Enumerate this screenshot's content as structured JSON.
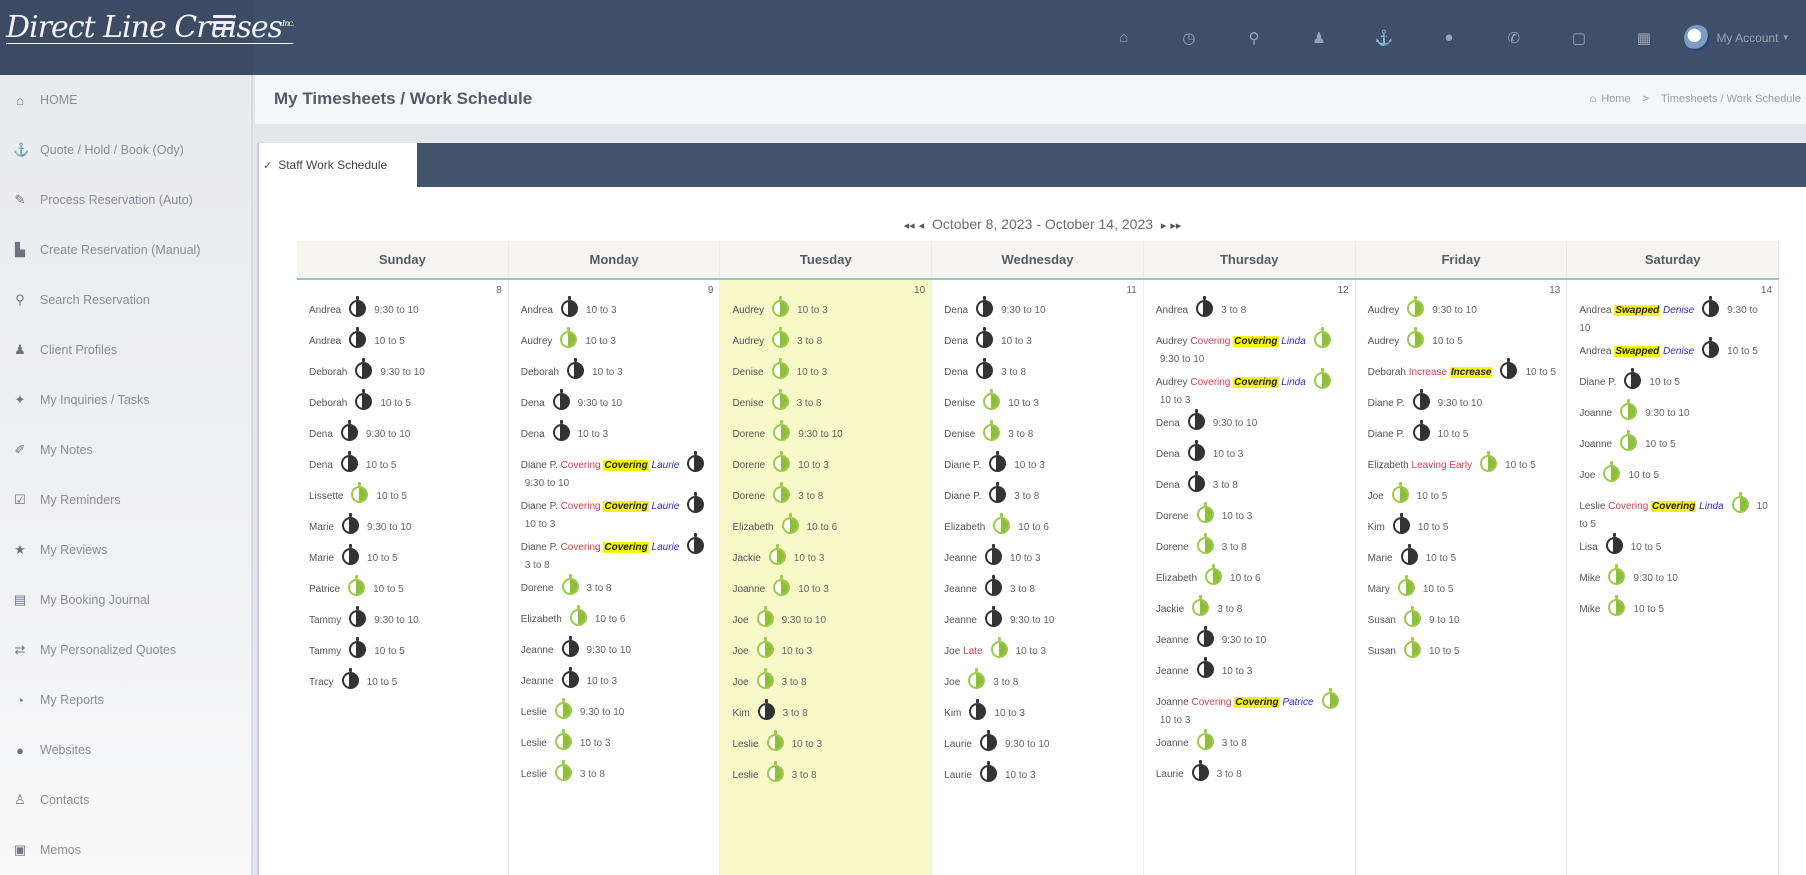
{
  "app": {
    "logo_text": "Direct Line Cruises",
    "logo_tm": "Inc."
  },
  "topnav": {
    "icons": [
      "home-icon",
      "clock-icon",
      "search-icon",
      "person-icon",
      "anchor-icon",
      "globe-icon",
      "phone-icon",
      "square-icon",
      "calendar-icon"
    ],
    "account_label": "My Account"
  },
  "sidebar": {
    "items": [
      {
        "icon": "home-icon",
        "glyph": "⌂",
        "label": "HOME"
      },
      {
        "icon": "anchor-icon",
        "glyph": "⚓",
        "label": "Quote / Hold / Book (Ody)"
      },
      {
        "icon": "pencil-icon",
        "glyph": "✎",
        "label": "Process Reservation (Auto)"
      },
      {
        "icon": "file-icon",
        "glyph": "▙",
        "label": "Create Reservation (Manual)"
      },
      {
        "icon": "search-icon",
        "glyph": "⚲",
        "label": "Search Reservation"
      },
      {
        "icon": "person-icon",
        "glyph": "♟",
        "label": "Client Profiles"
      },
      {
        "icon": "ticket-icon",
        "glyph": "✦",
        "label": "My Inquiries / Tasks"
      },
      {
        "icon": "paperclip-icon",
        "glyph": "✐",
        "label": "My Notes"
      },
      {
        "icon": "checkbox-icon",
        "glyph": "☑",
        "label": "My Reminders"
      },
      {
        "icon": "star-icon",
        "glyph": "★",
        "label": "My Reviews"
      },
      {
        "icon": "book-icon",
        "glyph": "▤",
        "label": "My Booking Journal"
      },
      {
        "icon": "exchange-icon",
        "glyph": "⇄",
        "label": "My Personalized Quotes"
      },
      {
        "icon": "dashboard-icon",
        "glyph": "◔",
        "label": "My Reports"
      },
      {
        "icon": "globe-icon",
        "glyph": "●",
        "label": "Websites"
      },
      {
        "icon": "user-icon",
        "glyph": "♙",
        "label": "Contacts"
      },
      {
        "icon": "memo-icon",
        "glyph": "▣",
        "label": "Memos"
      }
    ]
  },
  "header": {
    "title": "My Timesheets / Work Schedule",
    "breadcrumb": {
      "home": "Home",
      "separator": ">",
      "current": "Timesheets / Work Schedule"
    }
  },
  "tabs": [
    {
      "label": "Staff Work Schedule",
      "active": true
    }
  ],
  "week": {
    "range": "October 8, 2023 - October 14, 2023",
    "prev_prev": "◂◂",
    "prev": "◂",
    "next": "▸",
    "next_next": "▸▸"
  },
  "calendar": {
    "today_index": 2,
    "days": [
      {
        "name": "Sunday",
        "date": "8",
        "entries": [
          {
            "name": "Andrea",
            "status": "dark",
            "time": "9:30 to 10"
          },
          {
            "name": "Andrea",
            "status": "dark",
            "time": "10 to 5"
          },
          {
            "name": "Deborah",
            "status": "dark",
            "time": "9:30 to 10"
          },
          {
            "name": "Deborah",
            "status": "dark",
            "time": "10 to 5"
          },
          {
            "name": "Dena",
            "status": "dark",
            "time": "9:30 to 10"
          },
          {
            "name": "Dena",
            "status": "dark",
            "time": "10 to 5"
          },
          {
            "name": "Lissette",
            "status": "green",
            "time": "10 to 5"
          },
          {
            "name": "Marie",
            "status": "dark",
            "time": "9:30 to 10"
          },
          {
            "name": "Marie",
            "status": "dark",
            "time": "10 to 5"
          },
          {
            "name": "Patrice",
            "status": "green",
            "time": "10 to 5"
          },
          {
            "name": "Tammy",
            "status": "dark",
            "time": "9:30 to 10"
          },
          {
            "name": "Tammy",
            "status": "dark",
            "time": "10 to 5"
          },
          {
            "name": "Tracy",
            "status": "dark",
            "time": "10 to 5"
          }
        ]
      },
      {
        "name": "Monday",
        "date": "9",
        "entries": [
          {
            "name": "Andrea",
            "status": "dark",
            "time": "10 to 3"
          },
          {
            "name": "Audrey",
            "status": "green",
            "time": "10 to 3"
          },
          {
            "name": "Deborah",
            "status": "dark",
            "time": "10 to 3"
          },
          {
            "name": "Dena",
            "status": "dark",
            "time": "9:30 to 10"
          },
          {
            "name": "Dena",
            "status": "dark",
            "time": "10 to 3"
          },
          {
            "name": "Diane P.",
            "red": "Covering",
            "hl": "Covering",
            "blue": "Laurie",
            "status": "dark",
            "time": "9:30 to 10"
          },
          {
            "name": "Diane P.",
            "red": "Covering",
            "hl": "Covering",
            "blue": "Laurie",
            "status": "dark",
            "time": "10 to 3"
          },
          {
            "name": "Diane P.",
            "red": "Covering",
            "hl": "Covering",
            "blue": "Laurie",
            "status": "dark",
            "time": "3 to 8"
          },
          {
            "name": "Dorene",
            "status": "green",
            "time": "3 to 8"
          },
          {
            "name": "Elizabeth",
            "status": "green",
            "time": "10 to 6"
          },
          {
            "name": "Jeanne",
            "status": "dark",
            "time": "9:30 to 10"
          },
          {
            "name": "Jeanne",
            "status": "dark",
            "time": "10 to 3"
          },
          {
            "name": "Leslie",
            "status": "green",
            "time": "9:30 to 10"
          },
          {
            "name": "Leslie",
            "status": "green",
            "time": "10 to 3"
          },
          {
            "name": "Leslie",
            "status": "green",
            "time": "3 to 8"
          }
        ]
      },
      {
        "name": "Tuesday",
        "date": "10",
        "entries": [
          {
            "name": "Audrey",
            "status": "green",
            "time": "10 to 3"
          },
          {
            "name": "Audrey",
            "status": "green",
            "time": "3 to 8"
          },
          {
            "name": "Denise",
            "status": "green",
            "time": "10 to 3"
          },
          {
            "name": "Denise",
            "status": "green",
            "time": "3 to 8"
          },
          {
            "name": "Dorene",
            "status": "green",
            "time": "9:30 to 10"
          },
          {
            "name": "Dorene",
            "status": "green",
            "time": "10 to 3"
          },
          {
            "name": "Dorene",
            "status": "green",
            "time": "3 to 8"
          },
          {
            "name": "Elizabeth",
            "status": "green",
            "time": "10 to 6"
          },
          {
            "name": "Jackie",
            "status": "green",
            "time": "10 to 3"
          },
          {
            "name": "Joanne",
            "status": "green",
            "time": "10 to 3"
          },
          {
            "name": "Joe",
            "status": "green",
            "time": "9:30 to 10"
          },
          {
            "name": "Joe",
            "status": "green",
            "time": "10 to 3"
          },
          {
            "name": "Joe",
            "status": "green",
            "time": "3 to 8"
          },
          {
            "name": "Kim",
            "status": "dark",
            "time": "3 to 8"
          },
          {
            "name": "Leslie",
            "status": "green",
            "time": "10 to 3"
          },
          {
            "name": "Leslie",
            "status": "green",
            "time": "3 to 8"
          }
        ]
      },
      {
        "name": "Wednesday",
        "date": "11",
        "entries": [
          {
            "name": "Dena",
            "status": "dark",
            "time": "9:30 to 10"
          },
          {
            "name": "Dena",
            "status": "dark",
            "time": "10 to 3"
          },
          {
            "name": "Dena",
            "status": "dark",
            "time": "3 to 8"
          },
          {
            "name": "Denise",
            "status": "green",
            "time": "10 to 3"
          },
          {
            "name": "Denise",
            "status": "green",
            "time": "3 to 8"
          },
          {
            "name": "Diane P.",
            "status": "dark",
            "time": "10 to 3"
          },
          {
            "name": "Diane P.",
            "status": "dark",
            "time": "3 to 8"
          },
          {
            "name": "Elizabeth",
            "status": "green",
            "time": "10 to 6"
          },
          {
            "name": "Jeanne",
            "status": "dark",
            "time": "10 to 3"
          },
          {
            "name": "Jeanne",
            "status": "dark",
            "time": "3 to 8"
          },
          {
            "name": "Jeanne",
            "status": "dark",
            "time": "9:30 to 10"
          },
          {
            "name": "Joe",
            "red": "Late",
            "status": "green",
            "time": "10 to 3"
          },
          {
            "name": "Joe",
            "status": "green",
            "time": "3 to 8"
          },
          {
            "name": "Kim",
            "status": "dark",
            "time": "10 to 3"
          },
          {
            "name": "Laurie",
            "status": "dark",
            "time": "9:30 to 10"
          },
          {
            "name": "Laurie",
            "status": "dark",
            "time": "10 to 3"
          }
        ]
      },
      {
        "name": "Thursday",
        "date": "12",
        "entries": [
          {
            "name": "Andrea",
            "status": "dark",
            "time": "3 to 8"
          },
          {
            "name": "Audrey",
            "red": "Covering",
            "hl": "Covering",
            "blue": "Linda",
            "status": "green",
            "time": "9:30 to 10"
          },
          {
            "name": "Audrey",
            "red": "Covering",
            "hl": "Covering",
            "blue": "Linda",
            "status": "green",
            "time": "10 to 3"
          },
          {
            "name": "Dena",
            "status": "dark",
            "time": "9:30 to 10"
          },
          {
            "name": "Dena",
            "status": "dark",
            "time": "10 to 3"
          },
          {
            "name": "Dena",
            "status": "dark",
            "time": "3 to 8"
          },
          {
            "name": "Dorene",
            "status": "green",
            "time": "10 to 3"
          },
          {
            "name": "Dorene",
            "status": "green",
            "time": "3 to 8"
          },
          {
            "name": "Elizabeth",
            "status": "green",
            "time": "10 to 6"
          },
          {
            "name": "Jackie",
            "status": "green",
            "time": "3 to 8"
          },
          {
            "name": "Jeanne",
            "status": "dark",
            "time": "9:30 to 10"
          },
          {
            "name": "Jeanne",
            "status": "dark",
            "time": "10 to 3"
          },
          {
            "name": "Joanne",
            "red": "Covering",
            "hl": "Covering",
            "blue": "Patrice",
            "status": "green",
            "time": "10 to 3"
          },
          {
            "name": "Joanne",
            "status": "green",
            "time": "3 to 8"
          },
          {
            "name": "Laurie",
            "status": "dark",
            "time": "3 to 8"
          }
        ]
      },
      {
        "name": "Friday",
        "date": "13",
        "entries": [
          {
            "name": "Audrey",
            "status": "green",
            "time": "9:30 to 10"
          },
          {
            "name": "Audrey",
            "status": "green",
            "time": "10 to 5"
          },
          {
            "name": "Deborah",
            "red": "Increase",
            "hl": "Increase",
            "status": "dark",
            "time": "10 to 5"
          },
          {
            "name": "Diane P.",
            "status": "dark",
            "time": "9:30 to 10"
          },
          {
            "name": "Diane P.",
            "status": "dark",
            "time": "10 to 5"
          },
          {
            "name": "Elizabeth",
            "red": "Leaving Early",
            "status": "green",
            "time": "10 to 5"
          },
          {
            "name": "Joe",
            "status": "green",
            "time": "10 to 5"
          },
          {
            "name": "Kim",
            "status": "dark",
            "time": "10 to 5"
          },
          {
            "name": "Marie",
            "status": "dark",
            "time": "10 to 5"
          },
          {
            "name": "Mary",
            "status": "green",
            "time": "10 to 5"
          },
          {
            "name": "Susan",
            "status": "green",
            "time": "9 to 10"
          },
          {
            "name": "Susan",
            "status": "green",
            "time": "10 to 5"
          }
        ]
      },
      {
        "name": "Saturday",
        "date": "14",
        "entries": [
          {
            "name": "Andrea",
            "hl": "Swapped",
            "blue": "Denise",
            "status": "dark",
            "time": "9:30 to 10"
          },
          {
            "name": "Andrea",
            "hl": "Swapped",
            "blue": "Denise",
            "status": "dark",
            "time": "10 to 5"
          },
          {
            "name": "Diane P.",
            "status": "dark",
            "time": "10 to 5"
          },
          {
            "name": "Joanne",
            "status": "green",
            "time": "9:30 to 10"
          },
          {
            "name": "Joanne",
            "status": "green",
            "time": "10 to 5"
          },
          {
            "name": "Joe",
            "status": "green",
            "time": "10 to 5"
          },
          {
            "name": "Leslie",
            "red": "Covering",
            "hl": "Covering",
            "blue": "Linda",
            "status": "green",
            "time": "10 to 5"
          },
          {
            "name": "Lisa",
            "status": "dark",
            "time": "10 to 5"
          },
          {
            "name": "Mike",
            "status": "green",
            "time": "9:30 to 10"
          },
          {
            "name": "Mike",
            "status": "green",
            "time": "10 to 5"
          }
        ]
      }
    ]
  },
  "colors": {
    "topbar": "#3f4e69",
    "today_highlight": "#f8f9c8",
    "status_red": "#e13b4d",
    "status_highlight": "#f5f50e",
    "status_blue": "#2b2bd8",
    "clock_green": "#9ccb49",
    "clock_dark": "#333333"
  }
}
